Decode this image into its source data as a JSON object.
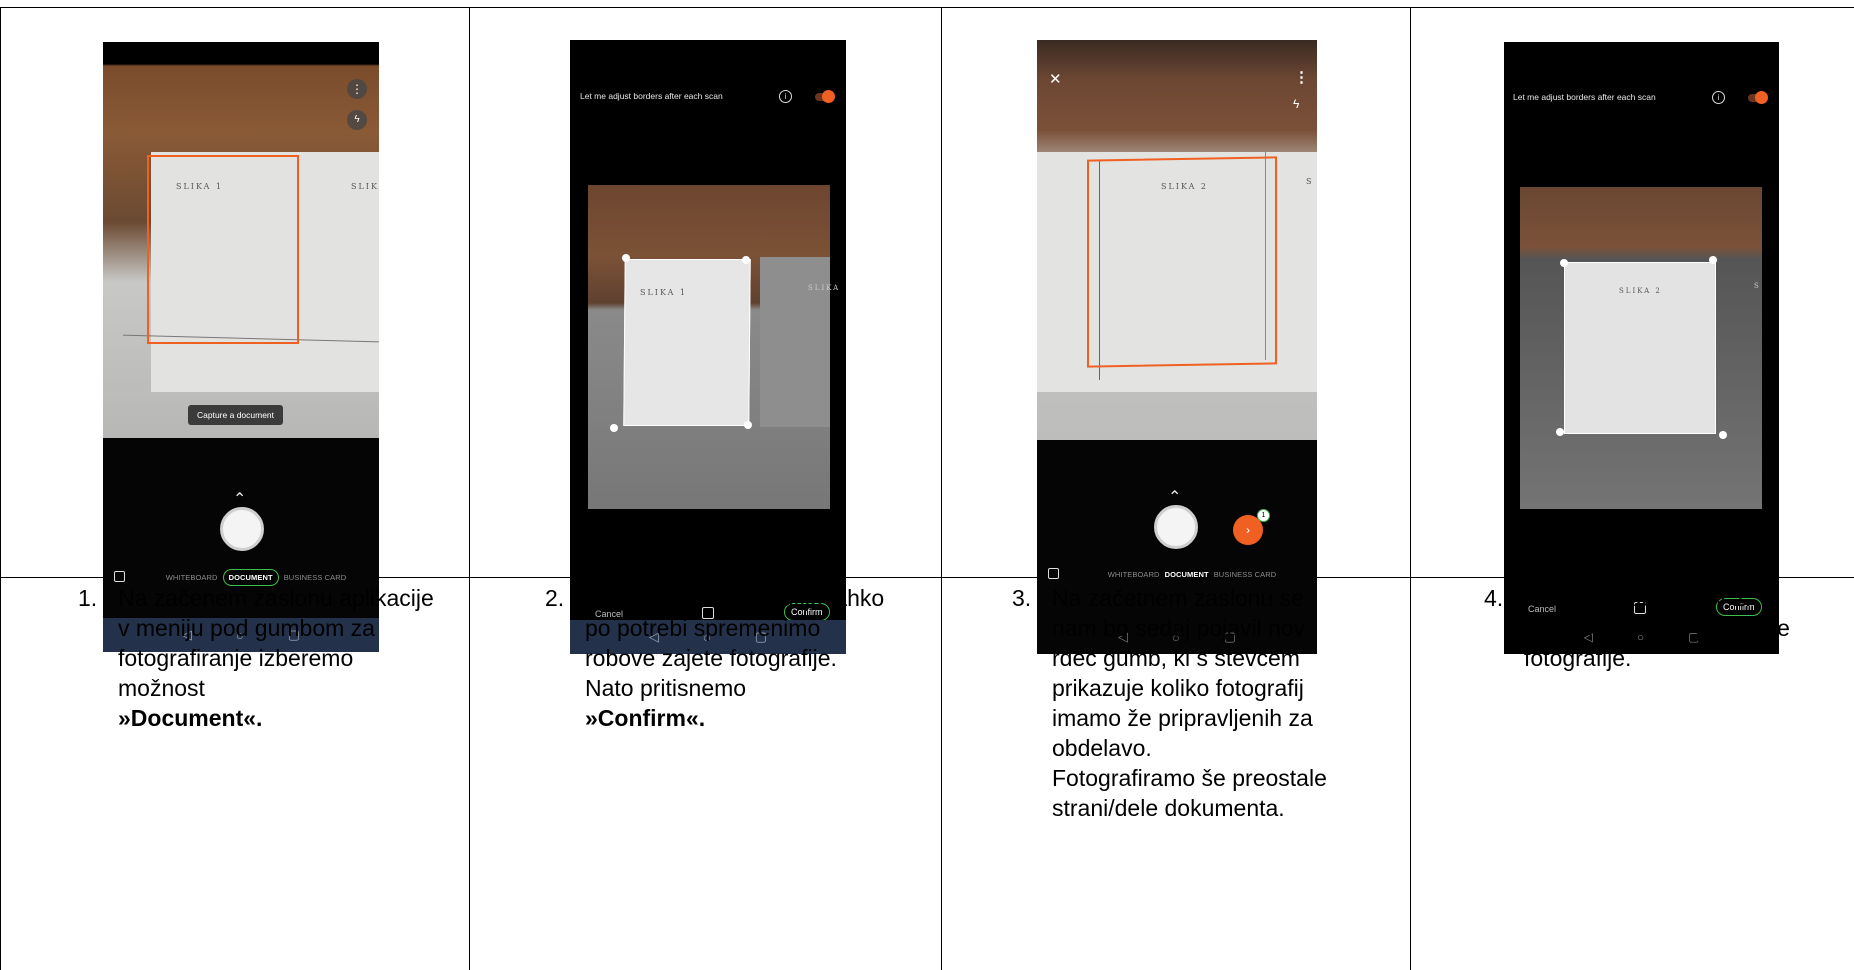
{
  "panels": [
    {
      "phone": {
        "flash_icon": "flash-off-icon",
        "menu_icon": "more-vertical-icon",
        "paper_label": "SLIKA 1",
        "paper_label_right": "SLIKA",
        "tooltip": "Capture a document",
        "modes": [
          "WHITEBOARD",
          "DOCUMENT",
          "BUSINESS CARD"
        ],
        "active_mode": "DOCUMENT"
      },
      "number": "1.",
      "text": "Na začenem zaslonu aplikacije v meniju pod gumbom za fotografiranje izberemo možnost",
      "bold": "»Document«."
    },
    {
      "phone": {
        "adjust_text": "Let me adjust borders after each scan",
        "paper_label": "SLIKA 1",
        "paper_label_right": "SLIKA",
        "cancel": "Cancel",
        "confirm": "Confirm"
      },
      "number": "2.",
      "text": "Ko naredimo fotografijo lahko po potrebi spremenimo robove zajete fotografije. Nato pritisnemo",
      "bold": "»Confirm«."
    },
    {
      "phone": {
        "paper_label": "SLIKA 2",
        "paper_label_right": "S",
        "badge_count": "1",
        "modes": [
          "WHITEBOARD",
          "DOCUMENT",
          "BUSINESS CARD"
        ],
        "active_mode": "DOCUMENT"
      },
      "number": "3.",
      "text": "Na začetnem zaslonu se nam bo sedaj pojavil nov rdeč gumb, ki s števcem prikazuje koliko fotografij imamo že pripravljenih za obdelavo.",
      "text2": "Fotografiramo še preostale strani/dele dokumenta."
    },
    {
      "phone": {
        "adjust_text": "Let me adjust borders after each scan",
        "paper_label": "SLIKA 2",
        "paper_label_right": "S",
        "cancel": "Cancel",
        "confirm": "Confirm"
      },
      "number": "4.",
      "text": "Na enak način kot v 2. koraku potrdimo preostale fotografije."
    }
  ],
  "colors": {
    "accent_orange": "#f06023",
    "confirm_green": "#3cbf4d",
    "nav_bar": "#23324a",
    "table_border": "#000000"
  }
}
